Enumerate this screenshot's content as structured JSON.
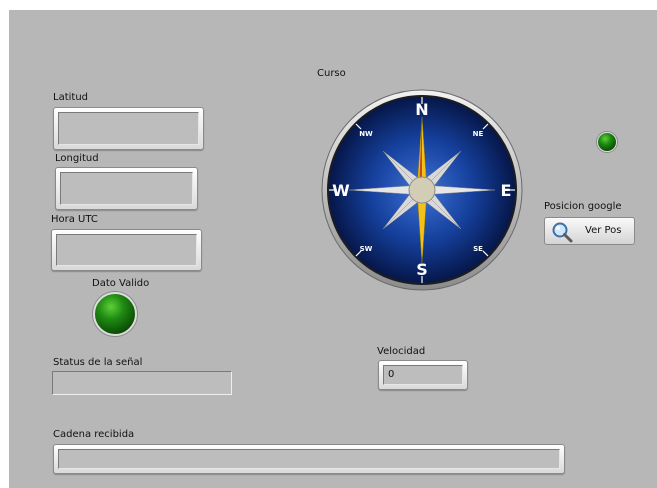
{
  "labels": {
    "latitud": "Latitud",
    "longitud": "Longitud",
    "hora_utc": "Hora UTC",
    "dato_valido": "Dato Valido",
    "status": "Status de la señal",
    "curso": "Curso",
    "velocidad": "Velocidad",
    "posicion_google": "Posicion google",
    "cadena": "Cadena recibida"
  },
  "values": {
    "latitud": "",
    "longitud": "",
    "hora_utc": "",
    "status": "",
    "velocidad": "0",
    "cadena": ""
  },
  "buttons": {
    "ver_pos": "Ver Pos",
    "ver_pos_icon": "magnifier-icon"
  },
  "compass": {
    "cardinals": {
      "n": "N",
      "s": "S",
      "e": "E",
      "w": "W"
    },
    "intercardinals": {
      "ne": "NE",
      "nw": "NW",
      "se": "SE",
      "sw": "SW"
    }
  },
  "colors": {
    "panel": "#b7b7b7",
    "led_on": "#1f8a12",
    "compass_face": "#0e2f86",
    "needle": "#e8b400"
  }
}
